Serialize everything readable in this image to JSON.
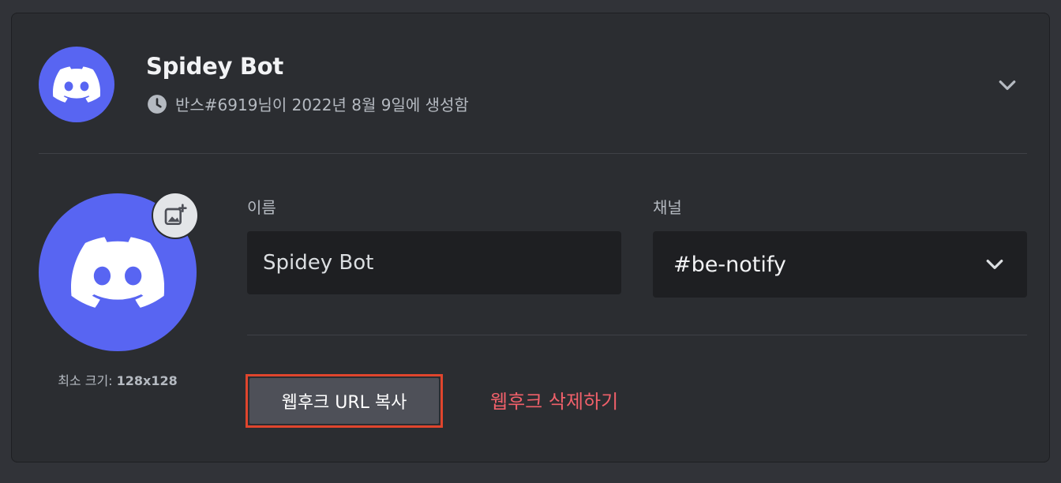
{
  "webhook": {
    "name": "Spidey Bot",
    "created_text": "반스#6919님이 2022년 8월 9일에 생성함",
    "avatar_icon": "discord-logo-icon"
  },
  "avatar_section": {
    "min_size_label": "최소 크기:",
    "min_size_value": "128x128"
  },
  "fields": {
    "name_label": "이름",
    "name_value": "Spidey Bot",
    "channel_label": "채널",
    "channel_value": "#be-notify"
  },
  "actions": {
    "copy_url_label": "웹후크 URL 복사",
    "delete_label": "웹후크 삭제하기"
  },
  "colors": {
    "brand": "#5865f2",
    "danger_text": "#f0606a",
    "highlight_outline": "#e0452d",
    "button_bg": "#4e5058"
  }
}
